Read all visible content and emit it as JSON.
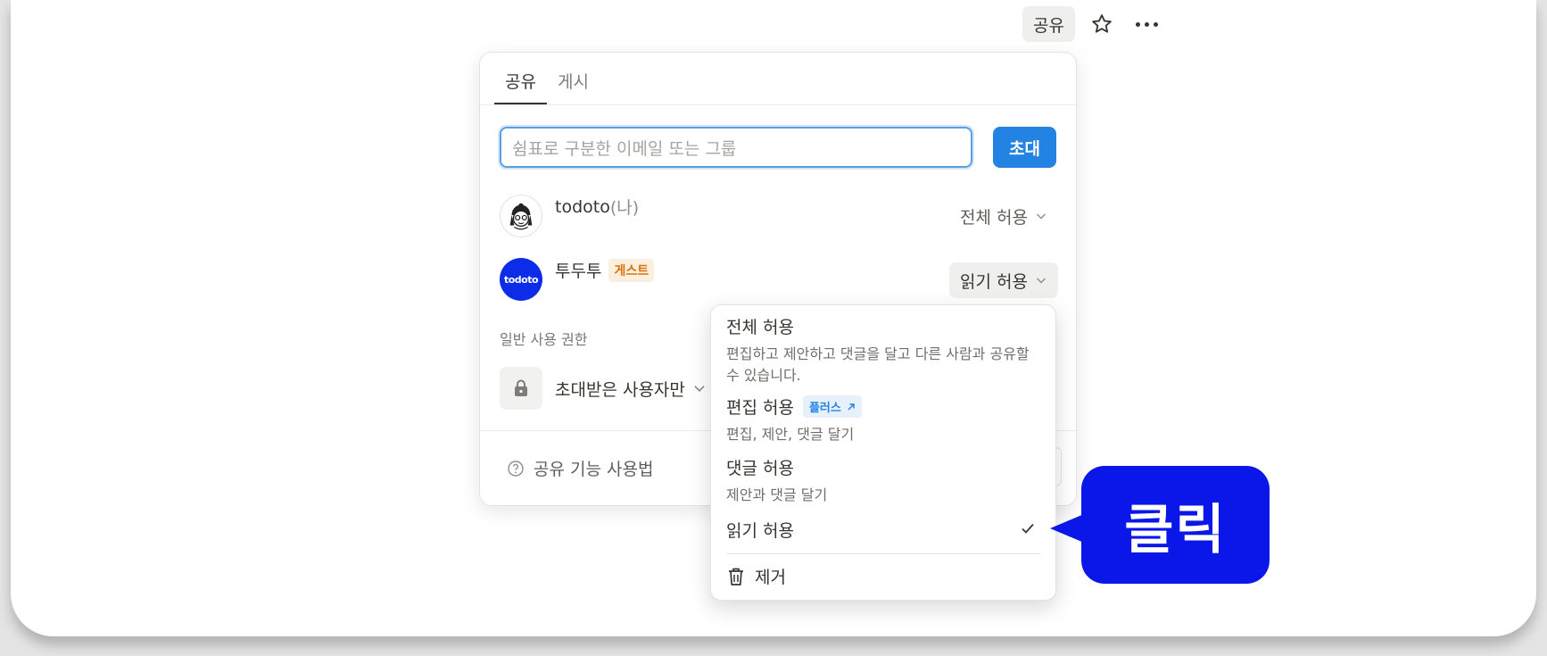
{
  "topbar": {
    "share_label": "공유",
    "icons": [
      "star-icon",
      "more-icon"
    ]
  },
  "share_panel": {
    "tabs": [
      {
        "label": "공유",
        "active": true
      },
      {
        "label": "게시",
        "active": false
      }
    ],
    "invite": {
      "placeholder": "쉼표로 구분한 이메일 또는 그룹",
      "button_label": "초대"
    },
    "members": [
      {
        "name": "todoto",
        "tag": "(나)",
        "permission": "전체 허용",
        "avatar": "illustrated-avatar"
      },
      {
        "name": "투두투",
        "badge": "게스트",
        "permission": "읽기 허용",
        "avatar_text": "todoto"
      }
    ],
    "general": {
      "label": "일반 사용 권한",
      "value": "초대받은 사용자만"
    },
    "help_label": "공유 기능 사용법"
  },
  "permission_menu": {
    "items": [
      {
        "title": "전체 허용",
        "description": "편집하고 제안하고 댓글을 달고 다른 사람과 공유할 수 있습니다."
      },
      {
        "title": "편집 허용",
        "badge": "플러스",
        "description": "편집, 제안, 댓글 달기"
      },
      {
        "title": "댓글 허용",
        "description": "제안과 댓글 달기"
      },
      {
        "title": "읽기 허용",
        "selected": true
      }
    ],
    "remove_label": "제거"
  },
  "callout": {
    "text": "클릭"
  },
  "colors": {
    "accent": "#2383e2",
    "callout": "#0b17e8",
    "guest_badge": "#d9730d",
    "avatar_brand": "#0d2ce8"
  }
}
